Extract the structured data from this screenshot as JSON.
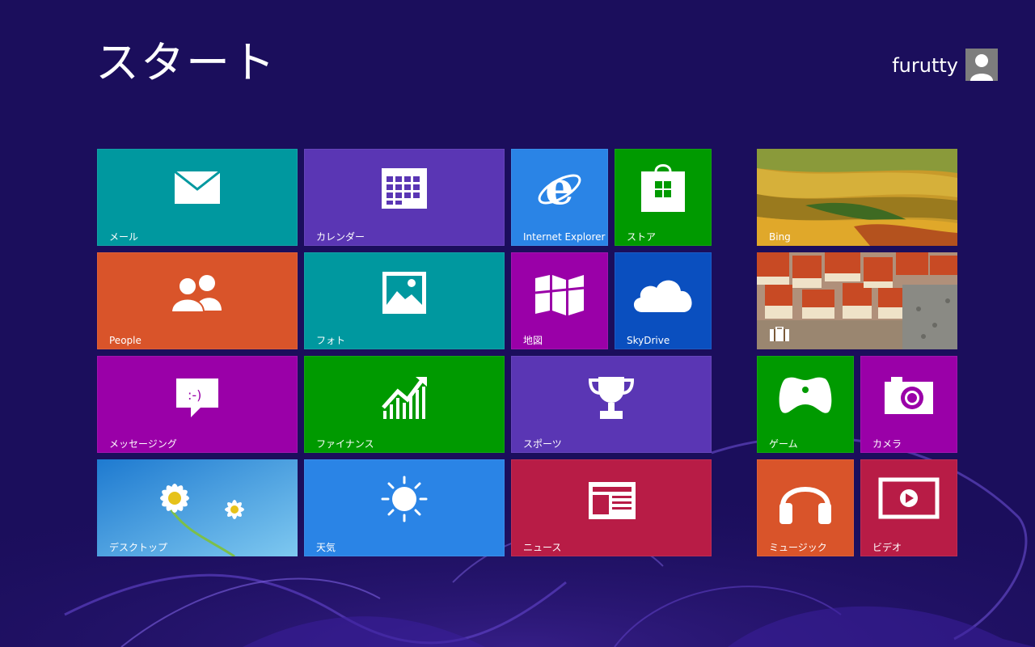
{
  "screen": {
    "title": "スタート"
  },
  "user": {
    "name": "furutty"
  },
  "colors": {
    "background": "#1b0e5c",
    "teal": "#00989f",
    "purple": "#5a36b4",
    "blue_ie": "#2a84e6",
    "green": "#009a00",
    "orange": "#d9542a",
    "magenta": "#9a00a8",
    "skyblue": "#0a4fbf",
    "red": "#b81c46"
  },
  "tiles": {
    "mail": {
      "label": "メール",
      "icon": "mail-icon"
    },
    "calendar": {
      "label": "カレンダー",
      "icon": "calendar-icon"
    },
    "ie": {
      "label": "Internet Explorer",
      "icon": "internet-explorer-icon"
    },
    "store": {
      "label": "ストア",
      "icon": "store-bag-icon"
    },
    "bing": {
      "label": "Bing",
      "icon": "landscape-photo"
    },
    "people": {
      "label": "People",
      "icon": "people-icon"
    },
    "photos": {
      "label": "フォト",
      "icon": "photo-icon"
    },
    "maps": {
      "label": "地図",
      "icon": "map-icon"
    },
    "skydrive": {
      "label": "SkyDrive",
      "icon": "cloud-icon"
    },
    "travel": {
      "label": "",
      "icon": "suitcase-icon"
    },
    "messaging": {
      "label": "メッセージング",
      "icon": "chat-bubble-icon"
    },
    "finance": {
      "label": "ファイナンス",
      "icon": "chart-icon"
    },
    "sports": {
      "label": "スポーツ",
      "icon": "trophy-icon"
    },
    "games": {
      "label": "ゲーム",
      "icon": "controller-icon"
    },
    "camera": {
      "label": "カメラ",
      "icon": "camera-icon"
    },
    "desktop": {
      "label": "デスクトップ",
      "icon": "daisy-wallpaper"
    },
    "weather": {
      "label": "天気",
      "icon": "sun-icon"
    },
    "news": {
      "label": "ニュース",
      "icon": "newspaper-icon"
    },
    "music": {
      "label": "ミュージック",
      "icon": "headphones-icon"
    },
    "video": {
      "label": "ビデオ",
      "icon": "play-screen-icon"
    }
  }
}
